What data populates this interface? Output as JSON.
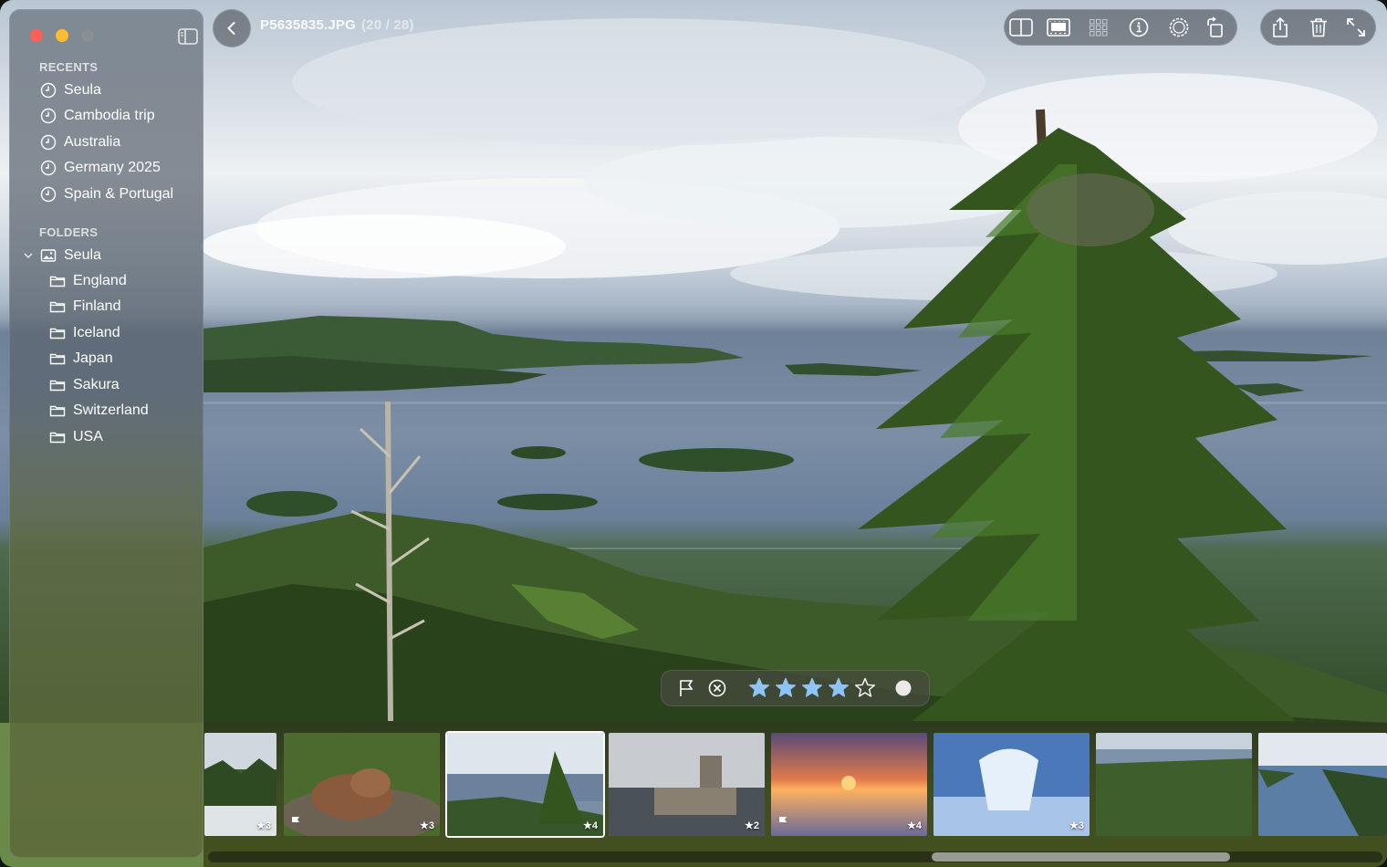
{
  "window": {
    "file_name": "P5635835.JPG",
    "position": "(20 / 28)"
  },
  "sidebar": {
    "recents_title": "RECENTS",
    "recents": [
      {
        "label": "Seula",
        "icon": "clock-icon"
      },
      {
        "label": "Cambodia trip",
        "icon": "clock-icon"
      },
      {
        "label": "Australia",
        "icon": "clock-icon"
      },
      {
        "label": "Germany 2025",
        "icon": "clock-icon"
      },
      {
        "label": "Spain & Portugal",
        "icon": "clock-icon"
      }
    ],
    "folders_title": "FOLDERS",
    "root_folder": {
      "label": "Seula",
      "icon": "photo-library-icon",
      "expanded": true
    },
    "folders": [
      {
        "label": "England",
        "icon": "folder-icon"
      },
      {
        "label": "Finland",
        "icon": "folder-icon"
      },
      {
        "label": "Iceland",
        "icon": "folder-icon"
      },
      {
        "label": "Japan",
        "icon": "folder-icon"
      },
      {
        "label": "Sakura",
        "icon": "folder-icon"
      },
      {
        "label": "Switzerland",
        "icon": "folder-icon"
      },
      {
        "label": "USA",
        "icon": "folder-icon"
      }
    ]
  },
  "toolbar": {
    "view_icons": [
      "split-view-icon",
      "filmstrip-view-icon",
      "grid-view-icon",
      "info-icon",
      "adjust-icon",
      "rotate-icon"
    ],
    "action_icons": [
      "share-icon",
      "trash-icon",
      "fullscreen-icon"
    ]
  },
  "rating_bar": {
    "flag_icon": "flag-icon",
    "reject_icon": "reject-icon",
    "rating": 4,
    "max_rating": 5,
    "color_label": "white",
    "star_color": "#8ec3f5"
  },
  "filmstrip": {
    "thumbs": [
      {
        "stars": "★3",
        "flag": false,
        "selected": false
      },
      {
        "stars": "★3",
        "flag": true,
        "selected": false
      },
      {
        "stars": "★4",
        "flag": false,
        "selected": true
      },
      {
        "stars": "★2",
        "flag": false,
        "selected": false
      },
      {
        "stars": "★4",
        "flag": true,
        "selected": false
      },
      {
        "stars": "★3",
        "flag": false,
        "selected": false
      },
      {
        "stars": "",
        "flag": false,
        "selected": false
      },
      {
        "stars": "",
        "flag": false,
        "selected": false
      }
    ]
  },
  "colors": {
    "close": "#ff5f57",
    "minimize": "#febc2e",
    "accent_star": "#8ec3f5"
  }
}
